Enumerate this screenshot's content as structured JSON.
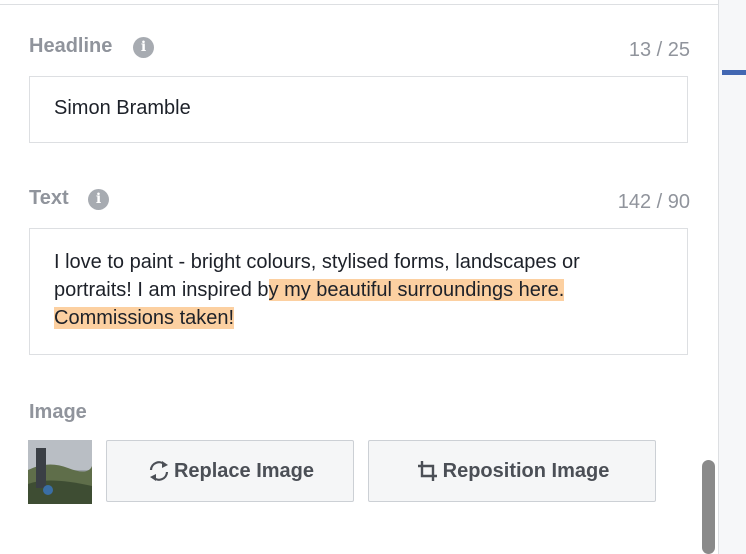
{
  "headline": {
    "label": "Headline",
    "counter": "13 / 25",
    "value": "Simon Bramble"
  },
  "text": {
    "label": "Text",
    "counter": "142 / 90",
    "value_normal": "I love to paint - bright colours, stylised forms, landscapes or portraits! I am inspired b",
    "value_highlighted": "y my beautiful surroundings here. Commissions taken!"
  },
  "image": {
    "label": "Image",
    "replace_label": "Replace Image",
    "reposition_label": "Reposition Image"
  },
  "icons": {
    "info": "info-icon",
    "replace": "refresh-icon",
    "reposition": "crop-icon"
  },
  "colors": {
    "highlight": "#fcd0a1",
    "accent": "#4267b2"
  }
}
